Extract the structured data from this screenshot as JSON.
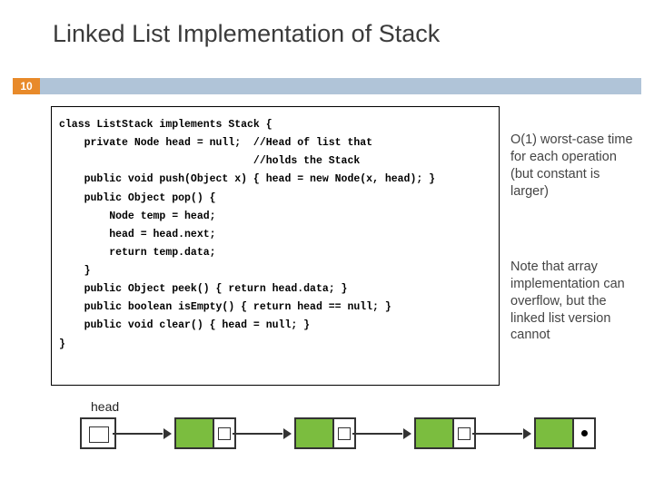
{
  "title": "Linked List Implementation of Stack",
  "slide_number": "10",
  "code": {
    "l1": "class ListStack implements Stack {",
    "l2": "    private Node head = null;  //Head of list that",
    "l3": "                               //holds the Stack",
    "l4": "    public void push(Object x) { head = new Node(x, head); }",
    "l5": "    public Object pop() {",
    "l6": "        Node temp = head;",
    "l7": "        head = head.next;",
    "l8": "        return temp.data;",
    "l9": "    }",
    "l10": "    public Object peek() { return head.data; }",
    "l11": "    public boolean isEmpty() { return head == null; }",
    "l12": "    public void clear() { head = null; }",
    "l13": "}"
  },
  "notes": {
    "n1": "O(1) worst-case time for each operation (but constant is larger)",
    "n2": "Note that array implementation can overflow, but the linked list version cannot"
  },
  "diagram": {
    "head_label": "head"
  }
}
